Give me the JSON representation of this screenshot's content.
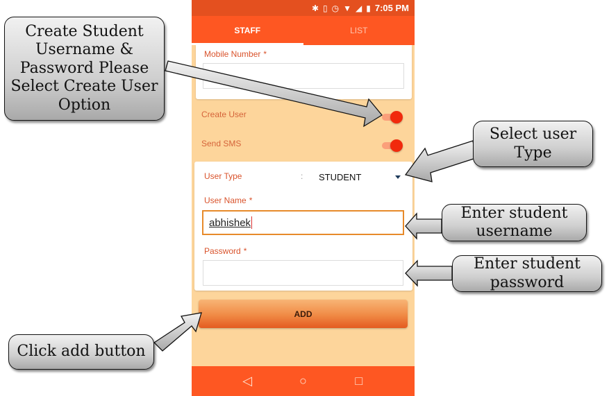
{
  "status_bar": {
    "icons": [
      "bluetooth-icon",
      "vibrate-icon",
      "alarm-icon",
      "wifi-icon",
      "signal-icon",
      "battery-icon"
    ],
    "time": "7:05 PM"
  },
  "tabs": [
    {
      "label": "STAFF",
      "active": true
    },
    {
      "label": "LIST",
      "active": false
    }
  ],
  "form": {
    "mobile_number": {
      "label": "Mobile Number",
      "required_mark": "*",
      "value": ""
    },
    "create_user": {
      "label": "Create User",
      "on": true
    },
    "send_sms": {
      "label": "Send SMS",
      "on": true
    },
    "user_type": {
      "label": "User Type",
      "separator": ":",
      "value": "STUDENT"
    },
    "user_name": {
      "label": "User Name",
      "required_mark": "*",
      "value": "abhishek"
    },
    "password": {
      "label": "Password",
      "required_mark": "*",
      "value": ""
    },
    "add_button": "ADD"
  },
  "nav_bar": {
    "back": "◁",
    "home": "○",
    "recents": "□"
  },
  "callouts": {
    "create_user": "Create Student Username & Password Please Select  Create User Option",
    "user_type": "Select user Type",
    "username": "Enter student username",
    "password": "Enter student password",
    "add": "Click add button"
  },
  "colors": {
    "primary": "#fe5722",
    "status_bar": "#e4501f",
    "background": "#fdd59b",
    "label": "#d9532c",
    "toggle_on": "#f12a0d"
  }
}
